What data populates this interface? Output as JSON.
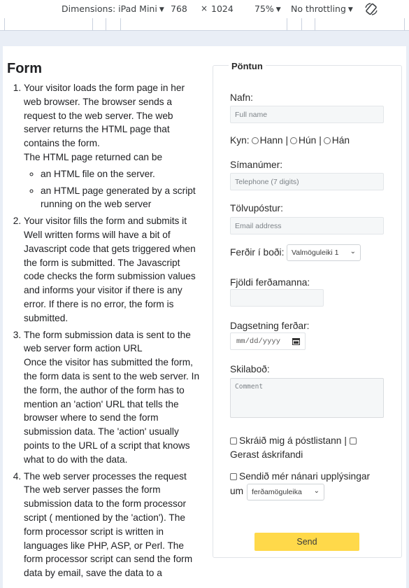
{
  "devtools": {
    "dimensions_label": "Dimensions: iPad Mini",
    "width": "768",
    "times": "×",
    "height": "1024",
    "zoom": "75%",
    "throttling": "No throttling",
    "rotate_icon": "rotate-icon"
  },
  "page": {
    "title": "Form",
    "steps": [
      {
        "heading": "Your visitor loads the form page in her web browser. The browser sends a request to the web server. The web server returns the HTML page that contains the form.",
        "body": "The HTML page returned can be",
        "sub": [
          "an HTML file on the server.",
          "an HTML page generated by a script running on the web server"
        ]
      },
      {
        "heading": "Your visitor fills the form and submits it",
        "body": "Well written forms will have a bit of Javascript code that gets triggered when the form is submitted. The Javascript code checks the form submission values and informs your visitor if there is any error. If there is no error, the form is submitted."
      },
      {
        "heading": "The form submission data is sent to the web server form action URL",
        "body": "Once the visitor has submitted the form, the form data is sent to the web server. In the form, the author of the form has to mention an 'action' URL that tells the browser where to send the form submission data. The 'action' usually points to the URL of a script that knows what to do with the data."
      },
      {
        "heading": "The web server processes the request",
        "body": "The web server passes the form submission data to the form processor script ( mentioned by the 'action'). The form processor script is written in languages like PHP, ASP, or Perl. The form processor script can send the form data by email, save the data to a"
      }
    ]
  },
  "form": {
    "legend": "Pöntun",
    "name_label": "Nafn:",
    "name_placeholder": "Full name",
    "gender_label": "Kyn:",
    "gender_options": [
      "Hann",
      "Hún",
      "Hán"
    ],
    "sep": "|",
    "phone_label": "Símanúmer:",
    "phone_placeholder": "Telephone (7 digits)",
    "email_label": "Tölvupóstur:",
    "email_placeholder": "Email address",
    "trips_label": "Ferðir í boði:",
    "trips_selected": "Valmöguleiki 1",
    "count_label": "Fjöldi ferðamanna:",
    "date_label": "Dagsetning ferðar:",
    "date_placeholder": "mm/dd/yyyy",
    "message_label": "Skilaboð:",
    "message_placeholder": "Comment",
    "subscribe_label": "Skráið mig á póstlistann",
    "subscriber_label": "Gerast áskrifandi",
    "more_info_label": "Sendið mér nánari upplýsingar",
    "more_info_um": "um",
    "more_info_selected": "ferðamöguleika",
    "send_label": "Send"
  }
}
